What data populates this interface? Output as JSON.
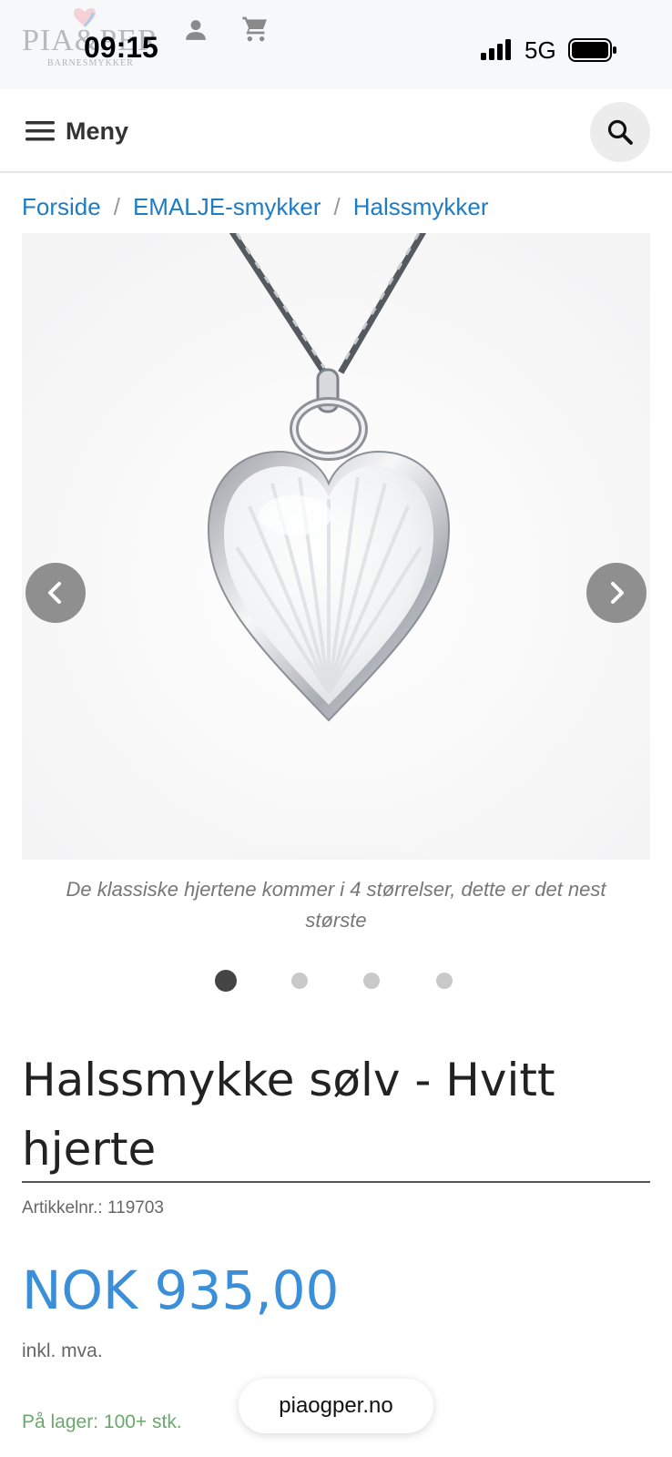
{
  "status_bar": {
    "time": "09:15",
    "network": "5G"
  },
  "brand": {
    "logo_text": "PIA&PER",
    "logo_subtext": "BARNESMYKKER"
  },
  "header": {
    "menu_label": "Meny"
  },
  "breadcrumb": [
    "Forside",
    "EMALJE-smykker",
    "Halssmykker"
  ],
  "breadcrumb_separator": "/",
  "gallery": {
    "caption": "De klassiske hjertene kommer i 4 størrelser, dette er det nest største",
    "slide_count": 4,
    "active_slide": 1
  },
  "product": {
    "title": "Halssmykke sølv - Hvitt hjerte",
    "sku_label": "Artikkelnr.:",
    "sku": "119703",
    "price": "NOK 935,00",
    "vat_note": "inkl. mva.",
    "stock": "På lager: 100+ stk."
  },
  "browser": {
    "url": "piaogper.no"
  },
  "colors": {
    "link": "#1e7bc4",
    "price": "#3b8fd8",
    "stock": "#6aa96c",
    "nav_button": "#8f8f8f"
  }
}
